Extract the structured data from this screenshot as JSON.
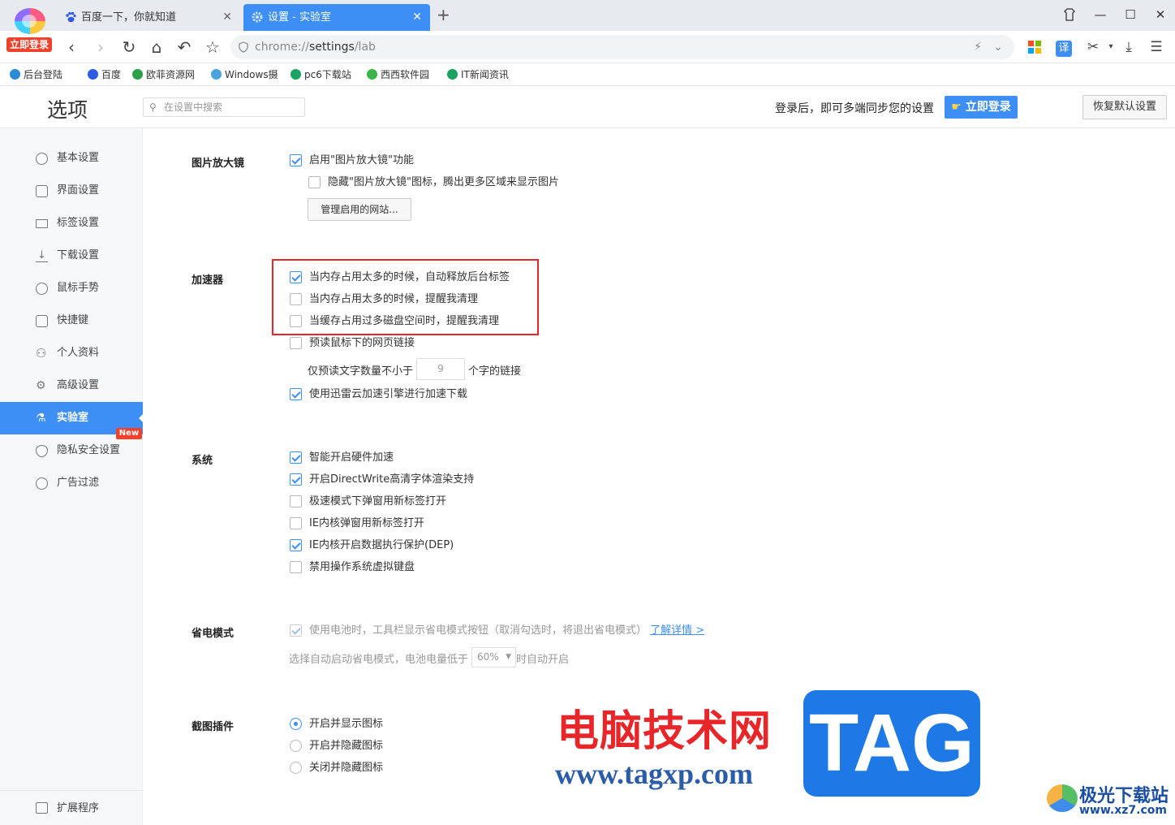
{
  "browser": {
    "login_badge": "立即登录",
    "tabs": [
      {
        "title": "百度一下，你就知道",
        "icon": "baidu-paw-icon",
        "active": false
      },
      {
        "title": "设置 - 实验室",
        "icon": "gear-icon",
        "active": true
      }
    ],
    "address": {
      "scheme": "chrome://",
      "path": "settings",
      "rest": "/lab"
    },
    "bookmarks": [
      {
        "label": "后台登陆",
        "color": "#2b8ad6"
      },
      {
        "label": "百度",
        "color": "#2d5be3"
      },
      {
        "label": "欧菲资源网",
        "color": "#2aa04a"
      },
      {
        "label": "Windows摄",
        "color": "#4aa3df"
      },
      {
        "label": "pc6下载站",
        "color": "#1aa260"
      },
      {
        "label": "西西软件园",
        "color": "#3bb54a"
      },
      {
        "label": "IT新闻资讯",
        "color": "#1aa260"
      }
    ]
  },
  "header": {
    "title": "选项",
    "search_placeholder": "在设置中搜索",
    "sync_text": "登录后，即可多端同步您的设置",
    "login_button": "立即登录",
    "restore_button": "恢复默认设置"
  },
  "sidebar": {
    "items": [
      {
        "label": "基本设置",
        "icon": "settings-circle-icon"
      },
      {
        "label": "界面设置",
        "icon": "window-icon"
      },
      {
        "label": "标签设置",
        "icon": "tab-icon"
      },
      {
        "label": "下载设置",
        "icon": "download-icon"
      },
      {
        "label": "鼠标手势",
        "icon": "mouse-icon"
      },
      {
        "label": "快捷键",
        "icon": "keyboard-icon"
      },
      {
        "label": "个人资料",
        "icon": "user-icon"
      },
      {
        "label": "高级设置",
        "icon": "advanced-icon"
      },
      {
        "label": "实验室",
        "icon": "flask-icon",
        "active": true
      },
      {
        "label": "隐私安全设置",
        "icon": "shield-icon"
      },
      {
        "label": "广告过滤",
        "icon": "block-icon"
      }
    ],
    "new_badge": "New",
    "extensions": "扩展程序"
  },
  "magnifier": {
    "title": "图片放大镜",
    "enable": "启用\"图片放大镜\"功能",
    "hide_icon": "隐藏\"图片放大镜\"图标，腾出更多区域来显示图片",
    "manage_button": "管理启用的网站..."
  },
  "accelerator": {
    "title": "加速器",
    "opt1": "当内存占用太多的时候，自动释放后台标签",
    "opt2": "当内存占用太多的时候，提醒我清理",
    "opt3": "当缓存占用过多磁盘空间时，提醒我清理",
    "opt4": "预读鼠标下的网页链接",
    "preread_prefix": "仅预读文字数量不小于",
    "preread_value": "9",
    "preread_suffix": "个字的链接",
    "opt5": "使用迅雷云加速引擎进行加速下载"
  },
  "system": {
    "title": "系统",
    "opt1": "智能开启硬件加速",
    "opt2": "开启DirectWrite高清字体渲染支持",
    "opt3": "极速模式下弹窗用新标签打开",
    "opt4": "IE内核弹窗用新标签打开",
    "opt5": "IE内核开启数据执行保护(DEP)",
    "opt6": "禁用操作系统虚拟键盘"
  },
  "power": {
    "title": "省电模式",
    "opt1": "使用电池时，工具栏显示省电模式按钮（取消勾选时，将退出省电模式）",
    "link": "了解详情 >",
    "auto_prefix": "选择自动启动省电模式，电池电量低于",
    "auto_value": "60%",
    "auto_suffix": "时自动开启"
  },
  "screenshot": {
    "title": "截图插件",
    "opt1": "开启并显示图标",
    "opt2": "开启并隐藏图标",
    "opt3": "关闭并隐藏图标"
  },
  "watermark": {
    "cn": "电脑技术网",
    "url": "www.tagxp.com",
    "tag": "TAG",
    "site_cn": "极光下载站",
    "site_url": "www.xz7.com"
  }
}
